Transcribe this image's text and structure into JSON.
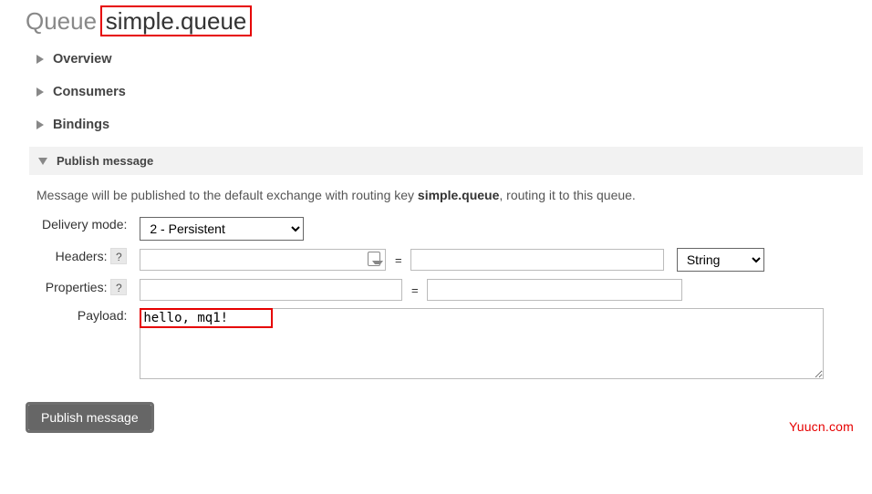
{
  "title": {
    "label": "Queue",
    "name": "simple.queue"
  },
  "sections": {
    "overview": {
      "label": "Overview"
    },
    "consumers": {
      "label": "Consumers"
    },
    "bindings": {
      "label": "Bindings"
    },
    "publish": {
      "label": "Publish message"
    }
  },
  "publish": {
    "info_prefix": "Message will be published to the default exchange with routing key ",
    "routing_key": "simple.queue",
    "info_suffix": ", routing it to this queue.",
    "delivery_mode": {
      "label": "Delivery mode:",
      "selected": "2 - Persistent"
    },
    "headers": {
      "label": "Headers:",
      "help": "?",
      "key": "",
      "equals": "=",
      "value": "",
      "type_selected": "String"
    },
    "properties": {
      "label": "Properties:",
      "help": "?",
      "key": "",
      "equals": "=",
      "value": ""
    },
    "payload": {
      "label": "Payload:",
      "value": "hello, mq1!"
    },
    "button": "Publish message"
  },
  "watermark": "Yuucn.com"
}
